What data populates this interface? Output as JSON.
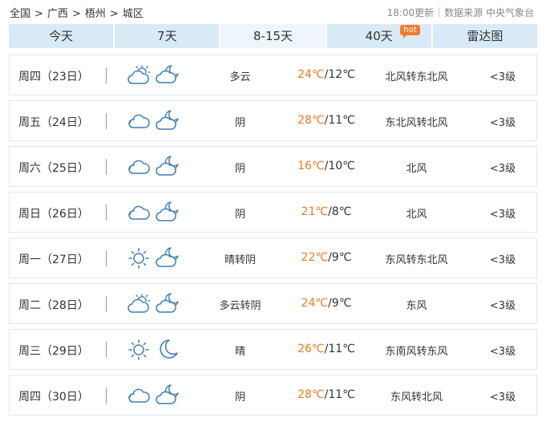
{
  "breadcrumb": {
    "items": [
      "全国",
      "广西",
      "梧州",
      "城区"
    ],
    "separator": ">"
  },
  "meta": {
    "updated": "18:00更新",
    "source": "数据来源 中央气象台"
  },
  "tabs": [
    {
      "label": "今天",
      "active": false
    },
    {
      "label": "7天",
      "active": false
    },
    {
      "label": "8-15天",
      "active": true
    },
    {
      "label": "40天",
      "active": false,
      "badge": "hot"
    },
    {
      "label": "雷达图",
      "active": false
    }
  ],
  "colors": {
    "tab_bg": "#d9eaf7",
    "tab_active_bg": "#eef6fc",
    "high_temp": "#f07a1e",
    "icon_stroke": "#3d7fb8",
    "hot_badge": "#f27b2b"
  },
  "forecast": [
    {
      "day": "周四（23日）",
      "icon_day": "partly-cloudy-day-icon",
      "icon_night": "partly-cloudy-night-icon",
      "desc": "多云",
      "high": "24℃",
      "low": "/12℃",
      "wind": "北风转东北风",
      "level": "<3级"
    },
    {
      "day": "周五（24日）",
      "icon_day": "cloudy-icon",
      "icon_night": "cloudy-night-icon",
      "desc": "阴",
      "high": "28℃",
      "low": "/11℃",
      "wind": "东北风转北风",
      "level": "<3级"
    },
    {
      "day": "周六（25日）",
      "icon_day": "cloudy-icon",
      "icon_night": "cloudy-night-icon",
      "desc": "阴",
      "high": "16℃",
      "low": "/10℃",
      "wind": "北风",
      "level": "<3级"
    },
    {
      "day": "周日（26日）",
      "icon_day": "cloudy-icon",
      "icon_night": "cloudy-night-icon",
      "desc": "阴",
      "high": "21℃",
      "low": "/8℃",
      "wind": "北风",
      "level": "<3级"
    },
    {
      "day": "周一（27日）",
      "icon_day": "sunny-icon",
      "icon_night": "cloudy-night-icon",
      "desc": "晴转阴",
      "high": "22℃",
      "low": "/9℃",
      "wind": "东风转东北风",
      "level": "<3级"
    },
    {
      "day": "周二（28日）",
      "icon_day": "partly-cloudy-day-icon",
      "icon_night": "cloudy-night-icon",
      "desc": "多云转阴",
      "high": "24℃",
      "low": "/9℃",
      "wind": "东风",
      "level": "<3级"
    },
    {
      "day": "周三（29日）",
      "icon_day": "sunny-icon",
      "icon_night": "moon-icon",
      "desc": "晴",
      "high": "26℃",
      "low": "/11℃",
      "wind": "东南风转东风",
      "level": "<3级"
    },
    {
      "day": "周四（30日）",
      "icon_day": "cloudy-icon",
      "icon_night": "cloudy-night-icon",
      "desc": "阴",
      "high": "28℃",
      "low": "/11℃",
      "wind": "东风转北风",
      "level": "<3级"
    }
  ]
}
